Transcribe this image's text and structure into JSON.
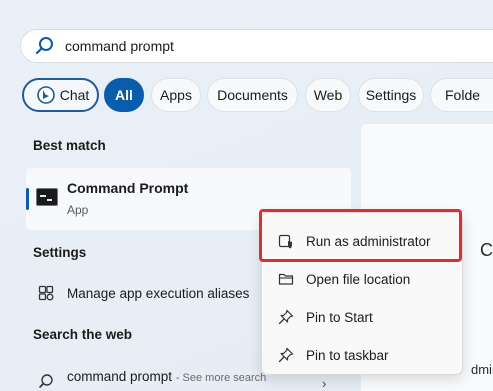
{
  "search": {
    "query": "command prompt",
    "icon": "search-icon"
  },
  "filters": {
    "chat": "Chat",
    "all": "All",
    "apps": "Apps",
    "documents": "Documents",
    "web": "Web",
    "settings": "Settings",
    "folders": "Folde"
  },
  "best_match": {
    "heading": "Best match",
    "title": "Command Prompt",
    "subtitle": "App"
  },
  "settings_section": {
    "heading": "Settings",
    "item": "Manage app execution aliases"
  },
  "web_section": {
    "heading": "Search the web",
    "query": "command prompt",
    "hint": "- See more search"
  },
  "context_menu": {
    "items": [
      {
        "label": "Run as administrator",
        "icon": "shield-admin-icon"
      },
      {
        "label": "Open file location",
        "icon": "folder-icon"
      },
      {
        "label": "Pin to Start",
        "icon": "pin-icon"
      },
      {
        "label": "Pin to taskbar",
        "icon": "pin-icon"
      }
    ]
  },
  "right_panel": {
    "partial_letter": "C",
    "partial_text": "dmin"
  },
  "colors": {
    "accent": "#0a5cad",
    "highlight": "#d9312f"
  }
}
